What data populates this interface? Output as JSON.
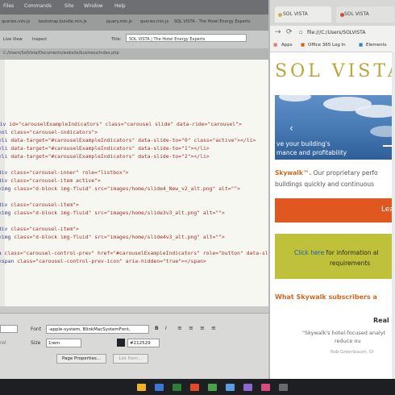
{
  "editor": {
    "menu": [
      "Files",
      "Commands",
      "Site",
      "Window",
      "Help"
    ],
    "tabs": [
      "queries.min.js",
      "bootstrap.bundle.min.js",
      "jquery.min.js",
      "queries.min.js",
      "SQL VISTA - The Hotel Energy Experts"
    ],
    "toolbar": {
      "live_view": "Live View",
      "inspect": "Inspect",
      "title_label": "Title:",
      "title_value": "SOL VISTA | The Hotel Energy Experts"
    },
    "path": "C:/Users/SolVista/Documents/website/business/index.php",
    "code_lines": [
      {
        "tag": "<div",
        "rest": " id=\"carouselExampleIndicators\" class=\"carousel slide\" data-ride=\"carousel\">"
      },
      {
        "tag": "<ol",
        "rest": " class=\"carousel-indicators\">"
      },
      {
        "tag": "<li",
        "rest": " data-target=\"#carouselExampleIndicators\" data-slide-to=\"0\" class=\"active\"></li>"
      },
      {
        "tag": "<li",
        "rest": " data-target=\"#carouselExampleIndicators\" data-slide-to=\"1\"></li>"
      },
      {
        "tag": "<li",
        "rest": " data-target=\"#carouselExampleIndicators\" data-slide-to=\"2\"></li>"
      },
      {
        "tag": "",
        "rest": ""
      },
      {
        "tag": "<div",
        "rest": " class=\"carousel-inner\" role=\"listbox\">"
      },
      {
        "tag": "<div",
        "rest": " class=\"carousel-item active\">"
      },
      {
        "tag": "<img",
        "rest": " class=\"d-block img-fluid\" src=\"images/home/slide4_New_v2_alt.png\" alt=\"\">"
      },
      {
        "tag": "",
        "rest": ""
      },
      {
        "tag": "<div",
        "rest": " class=\"carousel-item\">"
      },
      {
        "tag": "<img",
        "rest": " class=\"d-block img-fluid\" src=\"images/home/slide3v3_alt.png\" alt=\"\">"
      },
      {
        "tag": "",
        "rest": ""
      },
      {
        "tag": "<div",
        "rest": " class=\"carousel-item\">"
      },
      {
        "tag": "<img",
        "rest": " class=\"d-block img-fluid\" src=\"images/home/slide4v3_alt.png\" alt=\"\">"
      },
      {
        "tag": "",
        "rest": ""
      },
      {
        "tag": "<a",
        "rest": " class=\"carousel-control-prev\" href=\"#carouselExampleIndicators\" role=\"button\" data-slide"
      },
      {
        "tag": "<span",
        "rest": " class=\"carousel-control-prev-icon\" aria-hidden=\"true\"></span>"
      }
    ],
    "properties": {
      "font_label": "Font",
      "font_value": "-apple-system, BlinkMacSystemFont,",
      "size_label": "Size",
      "size_value": "1rem",
      "color_value": "#212529",
      "page_props_button": "Page Properties...",
      "list_item_button": "List Item..."
    }
  },
  "browser": {
    "tabs": [
      "SOL VISTA",
      "SOL VISTA"
    ],
    "address": "file:///C:/Users/SOLVISTA",
    "bookmarks": [
      "Apps",
      "Office 365 Log In",
      "Elements"
    ],
    "page": {
      "logo": "SOL VISTA",
      "hero_line1": "ve your building's",
      "hero_line2": "mance and profitability",
      "skywalk_brand": "Skywalk™.",
      "skywalk_line1": " Our proprietary perfo",
      "skywalk_line2": "buildings quickly and continuous",
      "cta": "Lea",
      "info_link": "Click here",
      "info_line1": " for information al",
      "info_line2": "requirements",
      "subscribers_heading": "What Skywalk subscribers a",
      "real_heading": "Real e",
      "quote": "\"Skywalk's hotel-focused analyt",
      "quote_line2": "reduce ou",
      "quote_author": "Rob Greenbaum, Di"
    }
  },
  "colors": {
    "accent_orange": "#e0581f",
    "info_green": "#bfc13a",
    "logo_gold": "#b6a73a",
    "code_tag": "#3d3d8a",
    "code_string": "#a03030"
  }
}
